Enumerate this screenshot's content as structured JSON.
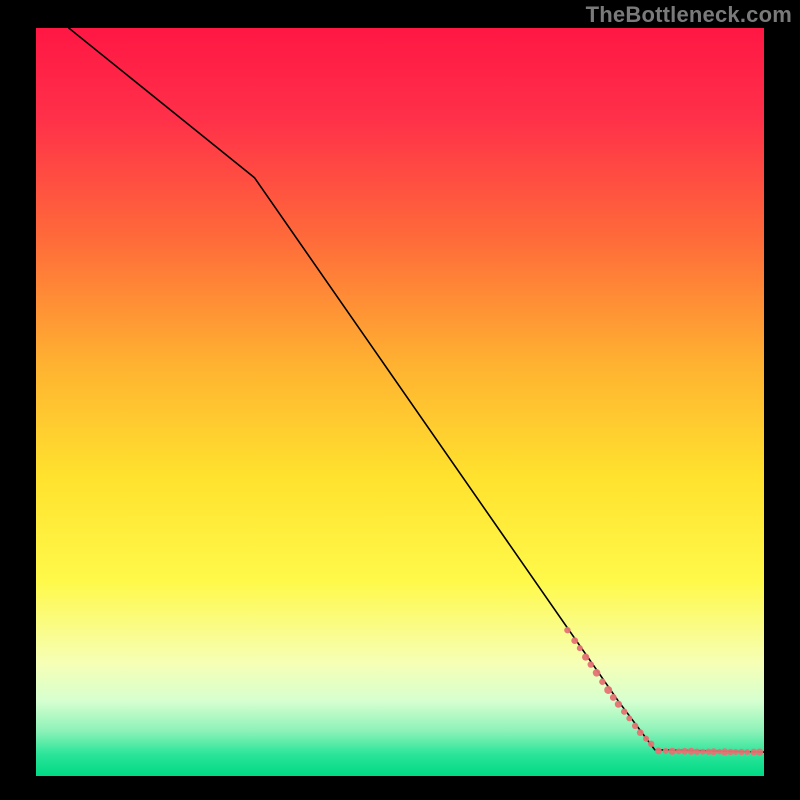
{
  "watermark": "TheBottleneck.com",
  "chart_data": {
    "type": "line",
    "title": "",
    "xlabel": "",
    "ylabel": "",
    "xlim": [
      0,
      100
    ],
    "ylim": [
      0,
      100
    ],
    "axes_visible": false,
    "background": {
      "type": "vertical_gradient",
      "stops": [
        {
          "pos": 0.0,
          "color": "#ff1744"
        },
        {
          "pos": 0.12,
          "color": "#ff3049"
        },
        {
          "pos": 0.28,
          "color": "#ff6a3a"
        },
        {
          "pos": 0.45,
          "color": "#ffb231"
        },
        {
          "pos": 0.6,
          "color": "#ffe22e"
        },
        {
          "pos": 0.74,
          "color": "#fff94a"
        },
        {
          "pos": 0.85,
          "color": "#f6ffb6"
        },
        {
          "pos": 0.9,
          "color": "#d6ffd0"
        },
        {
          "pos": 0.94,
          "color": "#8cf2b8"
        },
        {
          "pos": 0.97,
          "color": "#2de59a"
        },
        {
          "pos": 1.0,
          "color": "#00d985"
        }
      ]
    },
    "frame": {
      "color": "#000000",
      "left": 4.5,
      "right": 4.5,
      "top": 3.5,
      "bottom": 3.0
    },
    "series": [
      {
        "name": "curve",
        "type": "line",
        "x": [
          4.5,
          30,
          80,
          85,
          100
        ],
        "y": [
          100,
          80,
          10,
          3.5,
          3.2
        ],
        "color": "#000000",
        "width": 1.6
      },
      {
        "name": "points_on_curve",
        "type": "scatter",
        "color": "#e57373",
        "x": [
          73,
          74,
          74.7,
          75.5,
          76.2,
          77,
          77.8,
          78.6,
          79.3,
          80,
          80.8,
          81.5,
          82.3,
          83,
          83.8,
          84.5
        ],
        "y": [
          19.5,
          18.1,
          17.1,
          15.9,
          14.9,
          13.8,
          12.6,
          11.5,
          10.5,
          9.6,
          8.6,
          7.7,
          6.7,
          5.8,
          5.0,
          4.3
        ],
        "sizes": [
          3.2,
          3.4,
          3.0,
          3.6,
          3.2,
          3.8,
          3.2,
          4.0,
          3.4,
          3.6,
          3.2,
          3.0,
          3.2,
          3.4,
          3.0,
          3.2
        ]
      },
      {
        "name": "points_baseline",
        "type": "scatter",
        "color": "#e57373",
        "x": [
          85.5,
          86.5,
          87.4,
          88.3,
          89.1,
          90,
          90.8,
          91.6,
          92.4,
          93.1,
          93.9,
          94.6,
          95.4,
          96.1,
          96.9,
          97.7,
          98.6,
          99.4
        ],
        "y": [
          3.35,
          3.35,
          3.3,
          3.3,
          3.3,
          3.3,
          3.25,
          3.25,
          3.25,
          3.25,
          3.25,
          3.22,
          3.22,
          3.22,
          3.22,
          3.2,
          3.2,
          3.2
        ],
        "sizes": [
          3.4,
          3.0,
          3.6,
          3.0,
          3.4,
          3.6,
          3.2,
          3.0,
          3.2,
          3.4,
          2.8,
          3.6,
          3.2,
          3.0,
          3.2,
          3.0,
          3.4,
          3.6
        ]
      }
    ]
  }
}
